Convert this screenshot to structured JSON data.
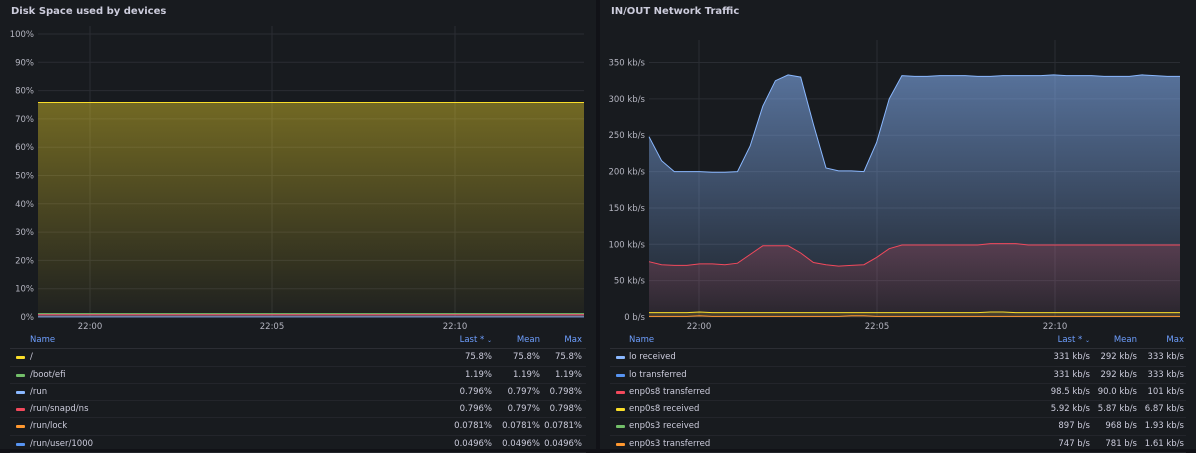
{
  "chart_data": [
    {
      "type": "area",
      "title": "Disk Space used by devices",
      "x_ticks": [
        "22:00",
        "22:05",
        "22:10"
      ],
      "y_ticks": [
        "0%",
        "10%",
        "20%",
        "30%",
        "40%",
        "50%",
        "60%",
        "70%",
        "80%",
        "90%",
        "100%"
      ],
      "ylim": [
        0,
        100
      ],
      "grid": true,
      "series": [
        {
          "name": "/",
          "color": "#fade2a",
          "value": 75.8
        },
        {
          "name": "/boot/efi",
          "color": "#73bf69",
          "value": 1.19
        },
        {
          "name": "/run",
          "color": "#8ab8ff",
          "value": 0.797
        },
        {
          "name": "/run/snapd/ns",
          "color": "#f2495c",
          "value": 0.797
        },
        {
          "name": "/run/lock",
          "color": "#ff9830",
          "value": 0.0781
        },
        {
          "name": "/run/user/1000",
          "color": "#5794f2",
          "value": 0.0496
        }
      ]
    },
    {
      "type": "area",
      "title": "IN/OUT Network Traffic",
      "x_ticks": [
        "22:00",
        "22:05",
        "22:10"
      ],
      "y_ticks": [
        "0 b/s",
        "50 kb/s",
        "100 kb/s",
        "150 kb/s",
        "200 kb/s",
        "250 kb/s",
        "300 kb/s",
        "350 kb/s"
      ],
      "ylim": [
        0,
        370
      ],
      "grid": true,
      "series": [
        {
          "name": "lo received",
          "color": "#8ab8ff",
          "values": [
            248,
            215,
            200,
            200,
            200,
            199,
            199,
            200,
            235,
            290,
            325,
            333,
            330,
            265,
            205,
            201,
            201,
            200,
            240,
            300,
            332,
            331,
            331,
            332,
            332,
            332,
            331,
            331,
            332,
            332,
            332,
            332,
            333,
            332,
            332,
            332,
            331,
            331,
            331,
            333,
            332,
            331,
            331
          ]
        },
        {
          "name": "enp0s8 transferred",
          "color": "#f2495c",
          "values": [
            76,
            72,
            71,
            71,
            73,
            73,
            72,
            74,
            86,
            98,
            98,
            98,
            88,
            75,
            72,
            70,
            71,
            72,
            82,
            94,
            99,
            99,
            99,
            99,
            99,
            99,
            99,
            101,
            101,
            101,
            99,
            99,
            99,
            99,
            99,
            99,
            99,
            99,
            99,
            99,
            99,
            99,
            99
          ]
        },
        {
          "name": "enp0s8 received",
          "color": "#fade2a",
          "values": [
            6,
            6,
            6,
            6,
            6.9,
            6,
            6,
            6,
            6,
            6,
            6,
            6,
            6,
            6,
            6,
            6,
            6,
            6,
            6,
            6,
            6,
            6,
            6,
            6,
            6,
            6,
            6,
            6.9,
            6.9,
            6,
            6,
            6,
            6,
            6,
            6,
            6,
            6,
            6,
            6,
            6,
            6,
            6,
            6
          ]
        },
        {
          "name": "enp0s3 transferred",
          "color": "#ff9830",
          "values": [
            0.8,
            0.8,
            0.8,
            0.8,
            1.6,
            0.8,
            0.8,
            0.8,
            0.8,
            0.8,
            0.8,
            0.8,
            0.8,
            0.8,
            0.8,
            0.8,
            1.6,
            1.6,
            0.8,
            0.8,
            0.8,
            0.8,
            0.8,
            0.8,
            0.8,
            0.8,
            0.8,
            0.8,
            0.8,
            0.8,
            0.8,
            0.8,
            0.8,
            0.8,
            0.8,
            0.8,
            0.8,
            0.8,
            0.8,
            0.8,
            0.8,
            0.8,
            0.8
          ]
        }
      ]
    }
  ],
  "disk_legend": {
    "header": {
      "name": "Name",
      "last": "Last *",
      "mean": "Mean",
      "max": "Max"
    },
    "rows": [
      {
        "name": "/",
        "color": "#fade2a",
        "last": "75.8%",
        "mean": "75.8%",
        "max": "75.8%"
      },
      {
        "name": "/boot/efi",
        "color": "#73bf69",
        "last": "1.19%",
        "mean": "1.19%",
        "max": "1.19%"
      },
      {
        "name": "/run",
        "color": "#8ab8ff",
        "last": "0.796%",
        "mean": "0.797%",
        "max": "0.798%"
      },
      {
        "name": "/run/snapd/ns",
        "color": "#f2495c",
        "last": "0.796%",
        "mean": "0.797%",
        "max": "0.798%"
      },
      {
        "name": "/run/lock",
        "color": "#ff9830",
        "last": "0.0781%",
        "mean": "0.0781%",
        "max": "0.0781%"
      },
      {
        "name": "/run/user/1000",
        "color": "#5794f2",
        "last": "0.0496%",
        "mean": "0.0496%",
        "max": "0.0496%"
      }
    ]
  },
  "net_legend": {
    "header": {
      "name": "Name",
      "last": "Last *",
      "mean": "Mean",
      "max": "Max"
    },
    "rows": [
      {
        "name": "lo received",
        "color": "#8ab8ff",
        "last": "331 kb/s",
        "mean": "292 kb/s",
        "max": "333 kb/s"
      },
      {
        "name": "lo transferred",
        "color": "#5794f2",
        "last": "331 kb/s",
        "mean": "292 kb/s",
        "max": "333 kb/s"
      },
      {
        "name": "enp0s8 transferred",
        "color": "#f2495c",
        "last": "98.5 kb/s",
        "mean": "90.0 kb/s",
        "max": "101 kb/s"
      },
      {
        "name": "enp0s8 received",
        "color": "#fade2a",
        "last": "5.92 kb/s",
        "mean": "5.87 kb/s",
        "max": "6.87 kb/s"
      },
      {
        "name": "enp0s3 received",
        "color": "#73bf69",
        "last": "897 b/s",
        "mean": "968 b/s",
        "max": "1.93 kb/s"
      },
      {
        "name": "enp0s3 transferred",
        "color": "#ff9830",
        "last": "747 b/s",
        "mean": "781 b/s",
        "max": "1.61 kb/s"
      }
    ]
  }
}
